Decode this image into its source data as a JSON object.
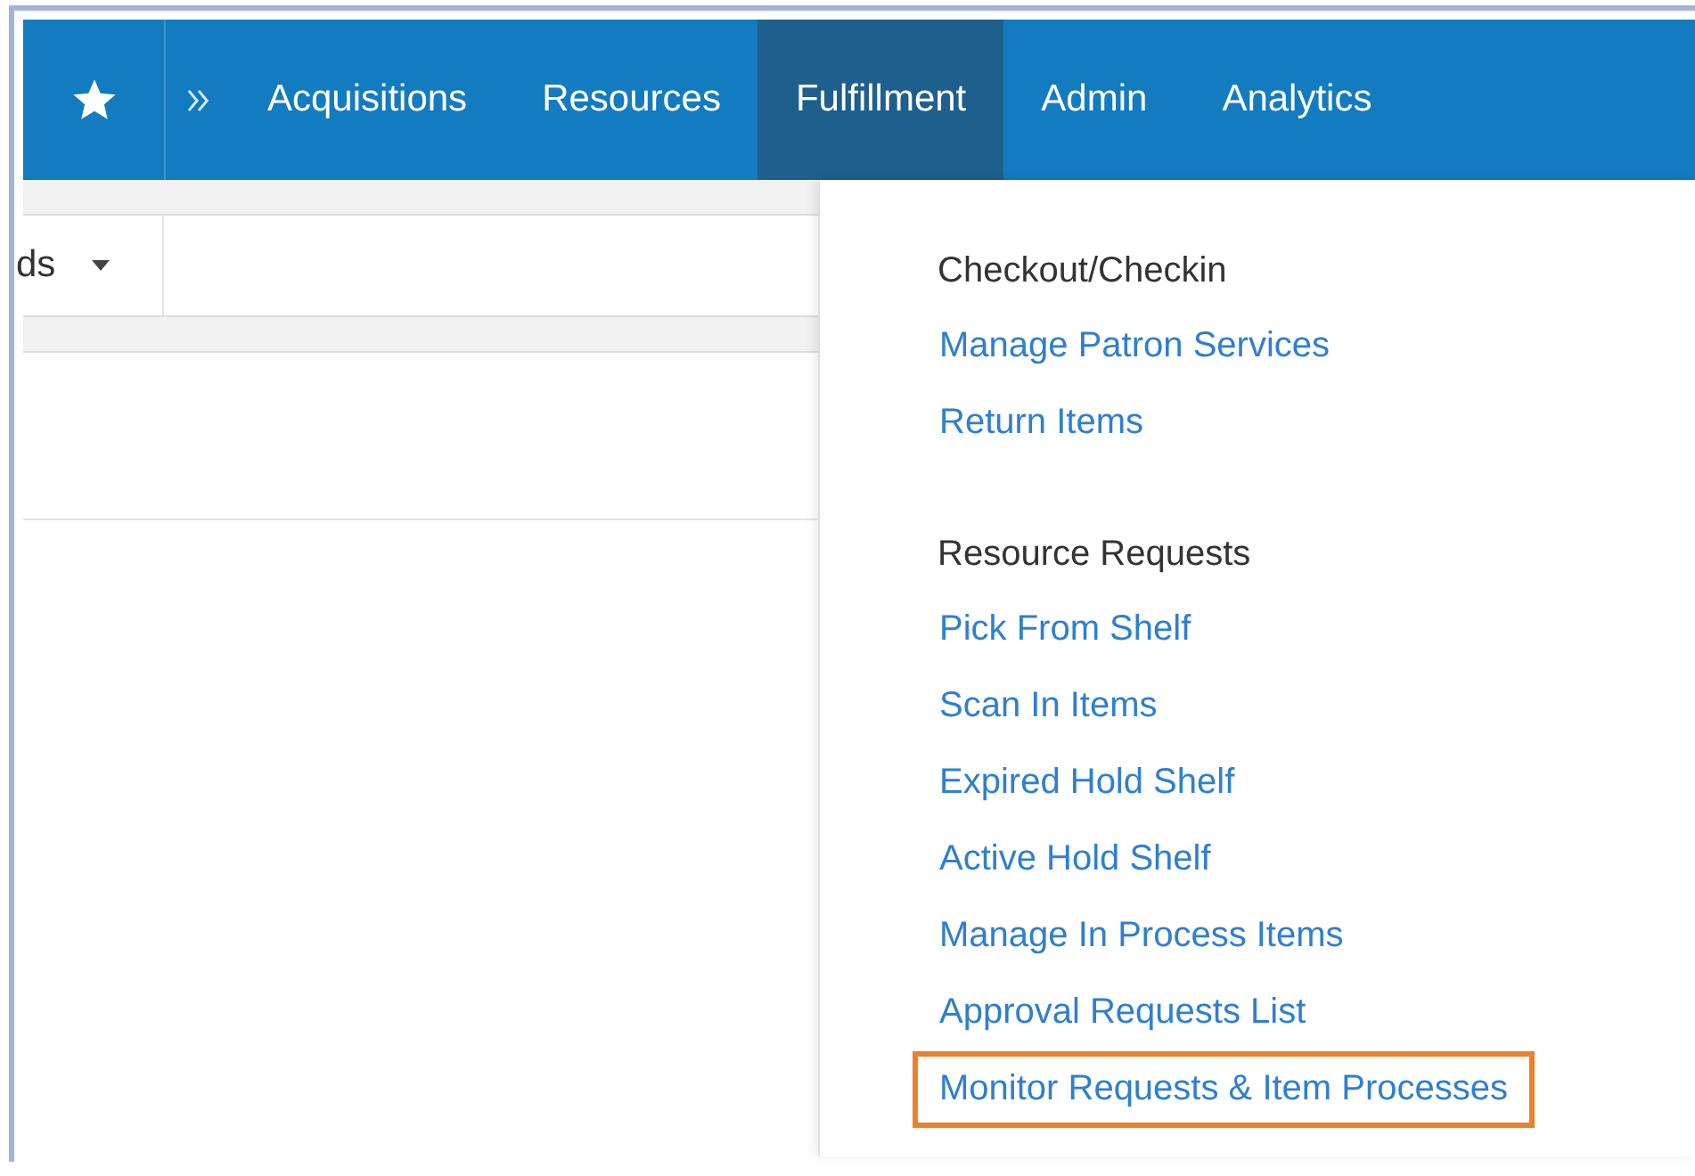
{
  "nav": {
    "items": [
      {
        "label": "Acquisitions",
        "selected": false
      },
      {
        "label": "Resources",
        "selected": false
      },
      {
        "label": "Fulfillment",
        "selected": true
      },
      {
        "label": "Admin",
        "selected": false
      },
      {
        "label": "Analytics",
        "selected": false
      }
    ]
  },
  "toolbar": {
    "dropdown": "ds"
  },
  "menu": {
    "groups": [
      {
        "heading": "Checkout/Checkin",
        "items": [
          {
            "label": "Manage Patron Services",
            "highlighted": false
          },
          {
            "label": "Return Items",
            "highlighted": false
          }
        ]
      },
      {
        "heading": "Resource Requests",
        "items": [
          {
            "label": "Pick From Shelf",
            "highlighted": false
          },
          {
            "label": "Scan In Items",
            "highlighted": false
          },
          {
            "label": "Expired Hold Shelf",
            "highlighted": false
          },
          {
            "label": "Active Hold Shelf",
            "highlighted": false
          },
          {
            "label": "Manage In Process Items",
            "highlighted": false
          },
          {
            "label": "Approval Requests List",
            "highlighted": false
          },
          {
            "label": "Monitor Requests & Item Processes",
            "highlighted": true
          }
        ]
      }
    ]
  }
}
